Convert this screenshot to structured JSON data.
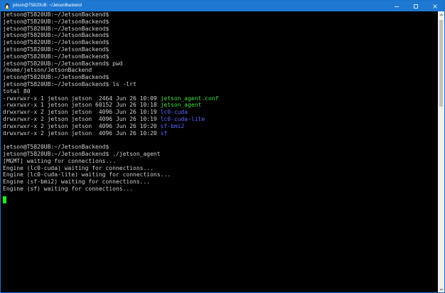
{
  "window": {
    "title": "jetson@T5820UB: ~/JetsonBackend",
    "icon": "linux-penguin-icon"
  },
  "controls": {
    "minimize": "minimize-icon",
    "maximize": "maximize-icon",
    "close": "close-icon"
  },
  "colors": {
    "titlebar": "#1e78d2",
    "background": "#000000",
    "text": "#d0d0d0",
    "executable": "#3fe03f",
    "directory": "#5a68ff",
    "cursor": "#1ef01e"
  },
  "terminal": {
    "lines": [
      {
        "segments": [
          {
            "text": "jetson@T5820UB:~/JetsonBackend$"
          }
        ]
      },
      {
        "segments": [
          {
            "text": "jetson@T5820UB:~/JetsonBackend$"
          }
        ]
      },
      {
        "segments": [
          {
            "text": "jetson@T5820UB:~/JetsonBackend$"
          }
        ]
      },
      {
        "segments": [
          {
            "text": "jetson@T5820UB:~/JetsonBackend$"
          }
        ]
      },
      {
        "segments": [
          {
            "text": "jetson@T5820UB:~/JetsonBackend$"
          }
        ]
      },
      {
        "segments": [
          {
            "text": "jetson@T5820UB:~/JetsonBackend$"
          }
        ]
      },
      {
        "segments": [
          {
            "text": "jetson@T5820UB:~/JetsonBackend$"
          }
        ]
      },
      {
        "segments": [
          {
            "text": "jetson@T5820UB:~/JetsonBackend$ pwd"
          }
        ]
      },
      {
        "segments": [
          {
            "text": "/home/jetson/JetsonBackend"
          }
        ]
      },
      {
        "segments": [
          {
            "text": "jetson@T5820UB:~/JetsonBackend$"
          }
        ]
      },
      {
        "segments": [
          {
            "text": "jetson@T5820UB:~/JetsonBackend$ ls -lrt"
          }
        ]
      },
      {
        "segments": [
          {
            "text": "total 80"
          }
        ]
      },
      {
        "segments": [
          {
            "text": "-rwxrwxr-x 1 jetson jetson  2464 Jun 26 10:09 "
          },
          {
            "text": "jetson_agent.conf",
            "cls": "exe"
          }
        ]
      },
      {
        "segments": [
          {
            "text": "-rwxrwxr-x 1 jetson jetson 60152 Jun 26 10:18 "
          },
          {
            "text": "jetson_agent",
            "cls": "exe"
          }
        ]
      },
      {
        "segments": [
          {
            "text": "drwxrwxr-x 2 jetson jetson  4096 Jun 26 10:19 "
          },
          {
            "text": "lc0-cuda",
            "cls": "dir"
          }
        ]
      },
      {
        "segments": [
          {
            "text": "drwxrwxr-x 2 jetson jetson  4096 Jun 26 10:19 "
          },
          {
            "text": "lc0-cuda-lite",
            "cls": "dir"
          }
        ]
      },
      {
        "segments": [
          {
            "text": "drwxrwxr-x 2 jetson jetson  4096 Jun 26 10:20 "
          },
          {
            "text": "sf-bmi2",
            "cls": "dir"
          }
        ]
      },
      {
        "segments": [
          {
            "text": "drwxrwxr-x 2 jetson jetson  4096 Jun 26 10:20 "
          },
          {
            "text": "sf",
            "cls": "dir"
          }
        ]
      },
      {
        "segments": [
          {
            "text": ""
          }
        ]
      },
      {
        "segments": [
          {
            "text": "jetson@T5820UB:~/JetsonBackend$"
          }
        ]
      },
      {
        "segments": [
          {
            "text": "jetson@T5820UB:~/JetsonBackend$ ./jetson_agent"
          }
        ]
      },
      {
        "segments": [
          {
            "text": "[MGMT] waiting for connections..."
          }
        ]
      },
      {
        "segments": [
          {
            "text": "Engine (lc0-cuda) waiting for connections..."
          }
        ]
      },
      {
        "segments": [
          {
            "text": "Engine (lc0-cuda-lite) waiting for connections..."
          }
        ]
      },
      {
        "segments": [
          {
            "text": "Engine (sf-bmi2) waiting for connections..."
          }
        ]
      },
      {
        "segments": [
          {
            "text": "Engine (sf) waiting for connections..."
          }
        ]
      }
    ]
  }
}
